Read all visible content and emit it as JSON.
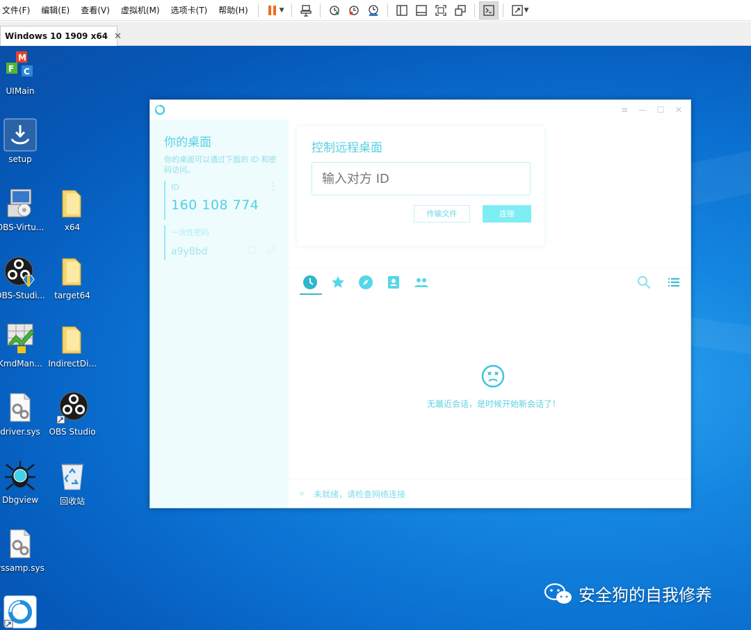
{
  "vmware": {
    "menu": [
      "文件(F)",
      "编辑(E)",
      "查看(V)",
      "虚拟机(M)",
      "选项卡(T)",
      "帮助(H)"
    ],
    "tab": {
      "title": "Windows 10 1909  x64",
      "close": "✕"
    }
  },
  "desktop": {
    "icons": [
      {
        "label": "UIMain"
      },
      {
        "label": "setup"
      },
      {
        "label": "OBS-Virtu..."
      },
      {
        "label": "x64"
      },
      {
        "label": "OBS-Studi..."
      },
      {
        "label": "target64"
      },
      {
        "label": "KmdMan..."
      },
      {
        "label": "IndirectDi..."
      },
      {
        "label": "driver.sys"
      },
      {
        "label": "OBS Studio"
      },
      {
        "label": "Dbgview"
      },
      {
        "label": "回收站"
      },
      {
        "label": "vssamp.sys"
      }
    ]
  },
  "app": {
    "window_controls": [
      "≡",
      "—",
      "☐",
      "✕"
    ],
    "left": {
      "title": "你的桌面",
      "description": "你的桌面可以通过下面的 ID 和密码访问。",
      "id_label": "ID",
      "id_value": "160 108 774",
      "password_label": "一次性密码",
      "password_value": "a9y8bd"
    },
    "control": {
      "title": "控制远程桌面",
      "input_placeholder": "输入对方 ID",
      "transfer_label": "传输文件",
      "connect_label": "连接"
    },
    "empty_message": "无最近会话，是时候开始新会话了！",
    "status": "未就绪，请检查网络连接"
  },
  "watermark": "安全狗的自我修养",
  "colors": {
    "accent": "#38b8cf",
    "desktop": "#0a6fd0"
  }
}
